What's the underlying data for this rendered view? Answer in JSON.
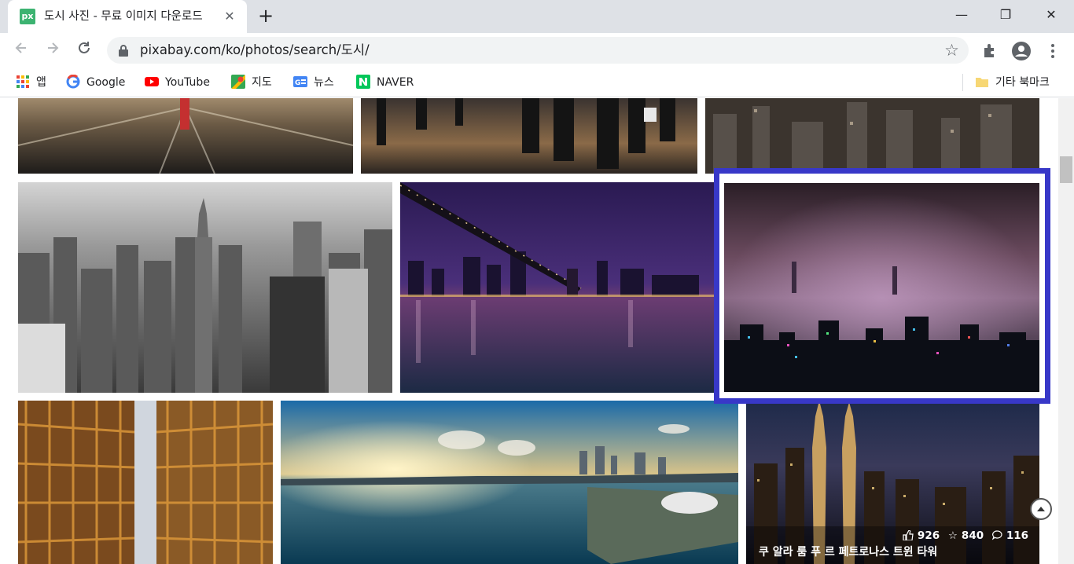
{
  "browser": {
    "tab": {
      "favicon_text": "px",
      "title": "도시 사진 - 무료 이미지 다운로드",
      "close_label": "✕"
    },
    "new_tab_label": "+",
    "window": {
      "minimize": "—",
      "maximize": "❐",
      "close": "✕"
    },
    "address_bar": {
      "url": "pixabay.com/ko/photos/search/도시/"
    },
    "bookmarks": [
      {
        "label": "앱",
        "icon": "apps-grid-icon"
      },
      {
        "label": "Google",
        "icon": "google-icon"
      },
      {
        "label": "YouTube",
        "icon": "youtube-icon"
      },
      {
        "label": "지도",
        "icon": "maps-icon"
      },
      {
        "label": "뉴스",
        "icon": "news-icon"
      },
      {
        "label": "NAVER",
        "icon": "naver-icon"
      }
    ],
    "other_bookmarks": "기타 북마크"
  },
  "gallery": {
    "highlighted_photo": "hong-kong-fog-night",
    "hover_card": {
      "likes": "926",
      "favorites": "840",
      "comments": "116",
      "title": "쿠 알라 룸 푸 르 페트로나스 트윈 타워"
    }
  },
  "colors": {
    "accent_highlight": "#3838c8",
    "chrome_bg": "#dee1e6"
  }
}
